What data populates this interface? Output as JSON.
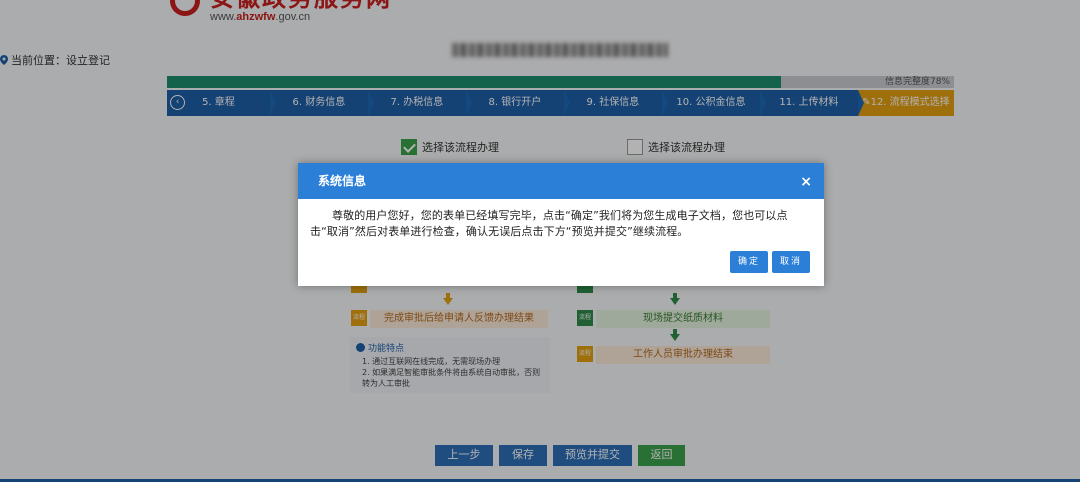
{
  "header": {
    "logo_title": "安徽政务服务网",
    "logo_url_prefix": "www.",
    "logo_url_brand": "ahzwfw",
    "logo_url_suffix": ".gov.cn"
  },
  "location": {
    "label": "当前位置：设立登记"
  },
  "progress": {
    "percent": 78,
    "text": "信息完整度78%"
  },
  "steps": [
    {
      "label": "5. 章程"
    },
    {
      "label": "6. 财务信息"
    },
    {
      "label": "7. 办税信息"
    },
    {
      "label": "8. 银行开户"
    },
    {
      "label": "9. 社保信息"
    },
    {
      "label": "10. 公积金信息"
    },
    {
      "label": "11. 上传材料"
    },
    {
      "label": "12. 流程模式选择"
    }
  ],
  "options": {
    "left": "选择该流程办理",
    "right": "选择该流程办理"
  },
  "flow": {
    "left_box": "完成审批后给申请人反馈办理结果",
    "right_box_1": "现场提交纸质材料",
    "right_box_2": "工作人员审批办理结束",
    "tag_left": "流程",
    "tag_right_1": "流程",
    "tag_right_2": "流程"
  },
  "features": {
    "title": "功能特点",
    "line1": "1. 通过互联网在线完成，无需现场办理",
    "line2": "2. 如果满足智能审批条件将由系统自动审批，否则",
    "line3": "转为人工审批"
  },
  "buttons": {
    "prev": "上一步",
    "save": "保存",
    "preview_submit": "预览并提交",
    "back": "返回"
  },
  "modal": {
    "title": "系统信息",
    "close": "×",
    "message": "尊敬的用户您好，您的表单已经填写完毕，点击“确定”我们将为您生成电子文档，您也可以点击“取消”然后对表单进行检查，确认无误后点击下方“预览并提交”继续流程。",
    "confirm": "确定",
    "cancel": "取消"
  },
  "colors": {
    "primary": "#2b7fd6",
    "step_bar": "#1f5fa6",
    "active_step": "#e39f10",
    "progress": "#1e8b6e",
    "brand_red": "#c8201f"
  }
}
